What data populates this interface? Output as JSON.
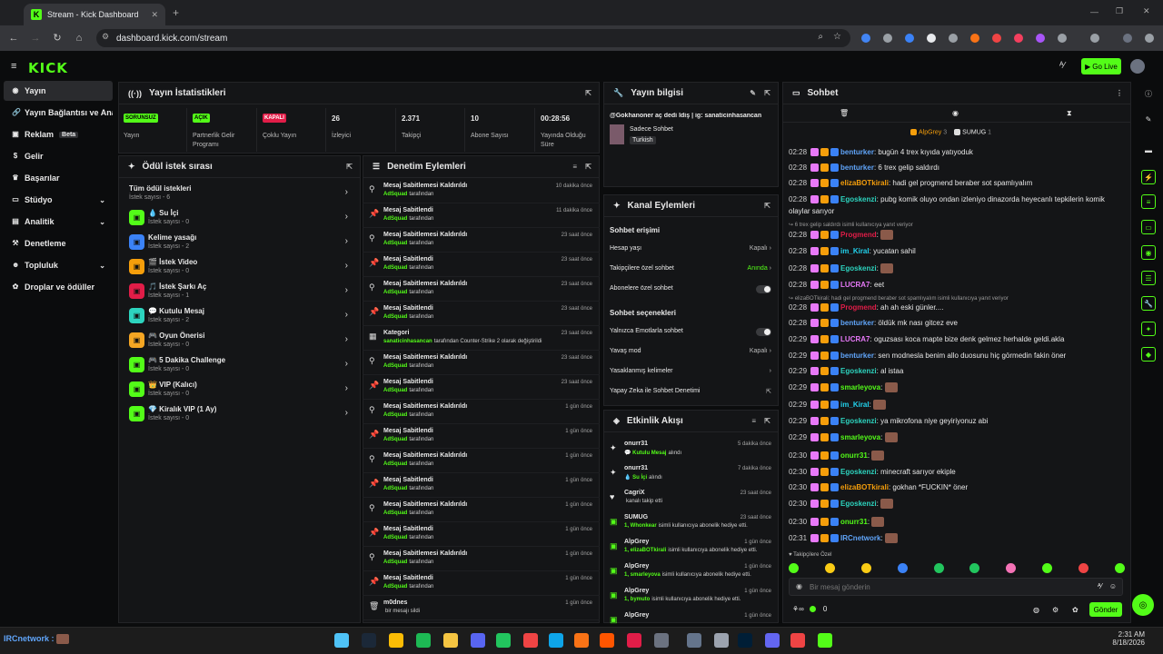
{
  "browser": {
    "tab_title": "Stream - Kick Dashboard",
    "url": "dashboard.kick.com/stream"
  },
  "header": {
    "logo": "KICK",
    "go_live": "Go Live"
  },
  "sidebar": {
    "items": [
      {
        "label": "Yayın",
        "icon": "broadcast-icon"
      },
      {
        "label": "Yayın Bağlantısı ve Anahtar",
        "icon": "link-icon"
      },
      {
        "label": "Reklam",
        "icon": "ad-icon",
        "badge": "Beta"
      },
      {
        "label": "Gelir",
        "icon": "money-icon"
      },
      {
        "label": "Başarılar",
        "icon": "trophy-icon"
      },
      {
        "label": "Stüdyo",
        "icon": "studio-icon"
      },
      {
        "label": "Analitik",
        "icon": "analytics-icon"
      },
      {
        "label": "Denetleme",
        "icon": "moderation-icon"
      },
      {
        "label": "Topluluk",
        "icon": "community-icon"
      },
      {
        "label": "Droplar ve ödüller",
        "icon": "gift-icon"
      }
    ]
  },
  "stats": {
    "title": "Yayın İstatistikleri",
    "cells": [
      {
        "badge": "SORUNSUZ",
        "label": "Yayın"
      },
      {
        "badge": "AÇIK",
        "label": "Partnerlik Gelir Programı"
      },
      {
        "badge": "KAPALI",
        "label": "Çoklu Yayın"
      },
      {
        "value": "26",
        "label": "İzleyici"
      },
      {
        "value": "2.371",
        "label": "Takipçi"
      },
      {
        "value": "10",
        "label": "Abone Sayısı"
      },
      {
        "value": "00:28:56",
        "label": "Yayında Olduğu Süre"
      }
    ]
  },
  "stream_info": {
    "title": "Yayın bilgisi",
    "stream_title": "@Gokhanoner aç dedi İdiş | ig: sanaticinhasancan",
    "category": "Sadece Sohbet",
    "tag": "Turkish"
  },
  "rewards": {
    "title": "Ödül istek sırası",
    "all_label": "Tüm ödül istekleri",
    "all_count": "İstek sayısı - 6",
    "items": [
      {
        "title": "💧 Su İçi",
        "count": "İstek sayısı - 0",
        "color": "#53fc18"
      },
      {
        "title": "Kelime yasağı",
        "count": "İstek sayısı - 2",
        "color": "#3b82f6"
      },
      {
        "title": "🎬 İstek Video",
        "count": "İstek sayısı - 0",
        "color": "#f59e0b"
      },
      {
        "title": "🎵 İstek Şarkı Aç",
        "count": "İstek sayısı - 1",
        "color": "#e11d48"
      },
      {
        "title": "💬 Kutulu Mesaj",
        "count": "İstek sayısı - 2",
        "color": "#2dd4bf"
      },
      {
        "title": "🎮 Oyun Önerisi",
        "count": "İstek sayısı - 0",
        "color": "#f5a623"
      },
      {
        "title": "🎮 5 Dakika Challenge",
        "count": "İstek sayısı - 0",
        "color": "#53fc18"
      },
      {
        "title": "👑 VIP (Kalıcı)",
        "count": "İstek sayısı - 0",
        "color": "#53fc18"
      },
      {
        "title": "💎 Kiralık VIP (1 Ay)",
        "count": "İstek sayısı - 0",
        "color": "#53fc18"
      }
    ]
  },
  "moderation": {
    "title": "Denetim Eylemleri",
    "items": [
      {
        "icon": "unpin-icon",
        "title": "Mesaj Sabitlemesi Kaldırıldı",
        "by": "AdSquad",
        "suffix": "tarafından",
        "time": "10 dakika önce"
      },
      {
        "icon": "pin-icon",
        "title": "Mesaj Sabitlendi",
        "by": "AdSquad",
        "suffix": "tarafından",
        "time": "11 dakika önce"
      },
      {
        "icon": "unpin-icon",
        "title": "Mesaj Sabitlemesi Kaldırıldı",
        "by": "AdSquad",
        "suffix": "tarafından",
        "time": "23 saat önce"
      },
      {
        "icon": "pin-icon",
        "title": "Mesaj Sabitlendi",
        "by": "AdSquad",
        "suffix": "tarafından",
        "time": "23 saat önce"
      },
      {
        "icon": "unpin-icon",
        "title": "Mesaj Sabitlemesi Kaldırıldı",
        "by": "AdSquad",
        "suffix": "tarafından",
        "time": "23 saat önce"
      },
      {
        "icon": "pin-icon",
        "title": "Mesaj Sabitlendi",
        "by": "AdSquad",
        "suffix": "tarafından",
        "time": "23 saat önce"
      },
      {
        "icon": "category-icon",
        "title": "Kategori",
        "by": "sanaticinhasancan",
        "suffix": "tarafından Counter-Strike 2 olarak değiştirildi",
        "time": "23 saat önce"
      },
      {
        "icon": "unpin-icon",
        "title": "Mesaj Sabitlemesi Kaldırıldı",
        "by": "AdSquad",
        "suffix": "tarafından",
        "time": "23 saat önce"
      },
      {
        "icon": "pin-icon",
        "title": "Mesaj Sabitlendi",
        "by": "AdSquad",
        "suffix": "tarafından",
        "time": "23 saat önce"
      },
      {
        "icon": "unpin-icon",
        "title": "Mesaj Sabitlemesi Kaldırıldı",
        "by": "AdSquad",
        "suffix": "tarafından",
        "time": "1 gün önce"
      },
      {
        "icon": "pin-icon",
        "title": "Mesaj Sabitlendi",
        "by": "AdSquad",
        "suffix": "tarafından",
        "time": "1 gün önce"
      },
      {
        "icon": "unpin-icon",
        "title": "Mesaj Sabitlemesi Kaldırıldı",
        "by": "AdSquad",
        "suffix": "tarafından",
        "time": "1 gün önce"
      },
      {
        "icon": "pin-icon",
        "title": "Mesaj Sabitlendi",
        "by": "AdSquad",
        "suffix": "tarafından",
        "time": "1 gün önce"
      },
      {
        "icon": "unpin-icon",
        "title": "Mesaj Sabitlemesi Kaldırıldı",
        "by": "AdSquad",
        "suffix": "tarafından",
        "time": "1 gün önce"
      },
      {
        "icon": "pin-icon",
        "title": "Mesaj Sabitlendi",
        "by": "AdSquad",
        "suffix": "tarafından",
        "time": "1 gün önce"
      },
      {
        "icon": "unpin-icon",
        "title": "Mesaj Sabitlemesi Kaldırıldı",
        "by": "AdSquad",
        "suffix": "tarafından",
        "time": "1 gün önce"
      },
      {
        "icon": "pin-icon",
        "title": "Mesaj Sabitlendi",
        "by": "AdSquad",
        "suffix": "tarafından",
        "time": "1 gün önce"
      },
      {
        "icon": "trash-icon",
        "title": "m0dnes",
        "by": "",
        "suffix": "bir mesajı sildi",
        "time": "1 gün önce"
      }
    ]
  },
  "channel_actions": {
    "title": "Kanal Eylemleri",
    "chat_access": "Sohbet erişimi",
    "account_age": "Hesap yaşı",
    "account_age_value": "Kapalı",
    "followers_only": "Takipçilere özel sohbet",
    "followers_only_value": "Anında",
    "subs_only": "Abonelere özel sohbet",
    "chat_options": "Sohbet seçenekleri",
    "emotes_only": "Yalnızca Emotlarla sohbet",
    "slow_mode": "Yavaş mod",
    "slow_mode_value": "Kapalı",
    "banned_words": "Yasaklanmış kelimeler",
    "ai_moderation": "Yapay Zeka ile Sohbet Denetimi"
  },
  "activity": {
    "title": "Etkinlik Akışı",
    "items": [
      {
        "name": "onurr31",
        "detail": "💬 Kutulu Mesaj",
        "detail2": "alındı",
        "time": "5 dakika önce",
        "icon": "reward-icon"
      },
      {
        "name": "onurr31",
        "detail": "💧 Su İçi",
        "detail2": "alındı",
        "time": "7 dakika önce",
        "icon": "reward-icon"
      },
      {
        "name": "CagriX",
        "detail": "",
        "detail2": "kanalı takip etti",
        "time": "23 saat önce",
        "icon": "heart-icon"
      },
      {
        "name": "SUMUG",
        "detail": "1, Whonkear",
        "detail2": "isimli kullanıcıya abonelik hediye etti.",
        "time": "23 saat önce",
        "icon": "gift-sub-icon"
      },
      {
        "name": "AlpGrey",
        "detail": "1, elizaBOTkirali",
        "detail2": "isimli kullanıcıya abonelik hediye etti.",
        "time": "1 gün önce",
        "icon": "gift-sub-icon"
      },
      {
        "name": "AlpGrey",
        "detail": "1, smarleyova",
        "detail2": "isimli kullanıcıya abonelik hediye etti.",
        "time": "1 gün önce",
        "icon": "gift-sub-icon"
      },
      {
        "name": "AlpGrey",
        "detail": "1, bymuto",
        "detail2": "isimli kullanıcıya abonelik hediye etti.",
        "time": "1 gün önce",
        "icon": "gift-sub-icon"
      },
      {
        "name": "AlpGrey",
        "detail": "",
        "detail2": "",
        "time": "1 gün önce",
        "icon": "gift-sub-icon"
      }
    ]
  },
  "chat": {
    "title": "Sohbet",
    "leaders": [
      {
        "name": "AlpGrey",
        "count": "3"
      },
      {
        "name": "SUMUG",
        "count": "1"
      }
    ],
    "messages": [
      {
        "time": "02:28",
        "user": "benturker",
        "color": "#60a5fa",
        "text": "bugün 4 trex kıyıda yatıyoduk"
      },
      {
        "time": "02:28",
        "user": "benturker",
        "color": "#60a5fa",
        "text": "6 trex gelip saldırdı"
      },
      {
        "time": "02:28",
        "user": "elizaBOTkirali",
        "color": "#f59e0b",
        "text": "hadi gel progmend beraber sot spamlıyalım"
      },
      {
        "time": "02:28",
        "user": "Egoskenzi",
        "color": "#2dd4bf",
        "text": "pubg komik oluyo ondan izleniyo dinazorda heyecanlı tepkilerin komik"
      },
      {
        "time": "",
        "user": "",
        "color": "",
        "text": "olaylar sarıyor"
      },
      {
        "time": "02:28",
        "user": "Progmend",
        "color": "#e11d48",
        "text": ""
      },
      {
        "time": "02:28",
        "user": "im_Kiral",
        "color": "#22d3ee",
        "text": "yucatan sahil"
      },
      {
        "time": "02:28",
        "user": "Egoskenzi",
        "color": "#2dd4bf",
        "text": ""
      },
      {
        "time": "02:28",
        "user": "LUCRA7",
        "color": "#e879f9",
        "text": "eet"
      },
      {
        "time": "02:28",
        "user": "Progmend",
        "color": "#e11d48",
        "text": "ah ah eski günler...."
      },
      {
        "time": "02:28",
        "user": "benturker",
        "color": "#60a5fa",
        "text": "öldük mk nası gitcez eve"
      },
      {
        "time": "02:29",
        "user": "LUCRA7",
        "color": "#e879f9",
        "text": "oguzsası koca mapte bize denk gelmez herhalde geldi.akla"
      },
      {
        "time": "02:29",
        "user": "benturker",
        "color": "#60a5fa",
        "text": "sen modnesla benim allo duosunu hiç görmedin fakin öner"
      },
      {
        "time": "02:29",
        "user": "Egoskenzi",
        "color": "#2dd4bf",
        "text": "al istaa"
      },
      {
        "time": "02:29",
        "user": "smarleyova",
        "color": "#53fc18",
        "text": ""
      },
      {
        "time": "02:29",
        "user": "im_Kiral",
        "color": "#22d3ee",
        "text": ""
      },
      {
        "time": "02:29",
        "user": "Egoskenzi",
        "color": "#2dd4bf",
        "text": "ya mikrofona niye geyiriyonuz abi"
      },
      {
        "time": "02:29",
        "user": "smarleyova",
        "color": "#53fc18",
        "text": ""
      },
      {
        "time": "02:30",
        "user": "onurr31",
        "color": "#53fc18",
        "text": ""
      },
      {
        "time": "02:30",
        "user": "Egoskenzi",
        "color": "#2dd4bf",
        "text": "minecraft sarıyor ekiple"
      },
      {
        "time": "02:30",
        "user": "elizaBOTkirali",
        "color": "#f59e0b",
        "text": "gokhan *FUCKIN* öner"
      },
      {
        "time": "02:30",
        "user": "Egoskenzi",
        "color": "#2dd4bf",
        "text": ""
      },
      {
        "time": "02:30",
        "user": "onurr31",
        "color": "#53fc18",
        "text": ""
      },
      {
        "time": "02:31",
        "user": "IRCnetwork",
        "color": "#60a5fa",
        "text": ""
      }
    ],
    "replies": [
      "6 trex gelip saldırdı isimli kullanıcıya yanıt veriyor",
      "elizaBOTkirali: hadi gel progmend beraber sot spamlıyalım isimli kullanıcıya yanıt veriyor"
    ],
    "followers_only": "Takipçilere Özel",
    "placeholder": "Bir mesaj gönderin",
    "points": "0",
    "send": "Gönder"
  },
  "taskbar": {
    "status_user": "IRCnetwork :",
    "time": "2:31 AM",
    "date": "8/18/2026"
  }
}
